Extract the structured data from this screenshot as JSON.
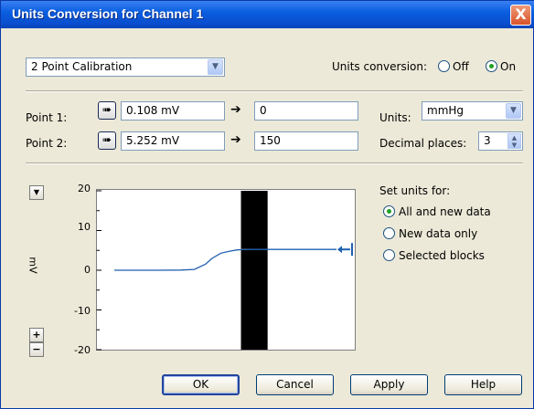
{
  "window": {
    "title": "Units Conversion for Channel 1",
    "close_glyph": "X"
  },
  "mode_select": {
    "value": "2 Point Calibration"
  },
  "units_conversion": {
    "label": "Units conversion:",
    "off_label": "Off",
    "on_label": "On",
    "selected": "On"
  },
  "points": [
    {
      "label": "Point 1:",
      "measured": "0.108 mV",
      "converted": "0"
    },
    {
      "label": "Point 2:",
      "measured": "5.252 mV",
      "converted": "150"
    }
  ],
  "units": {
    "label": "Units:",
    "value": "mmHg"
  },
  "decimal_places": {
    "label": "Decimal places:",
    "value": "3"
  },
  "chart": {
    "y_axis_label": "mV",
    "y_ticks": [
      "20",
      "10",
      "0",
      "-10",
      "-20"
    ],
    "zoom_in": "+",
    "zoom_out": "−"
  },
  "chart_data": {
    "type": "line",
    "ylabel": "mV",
    "ylim": [
      -20,
      20
    ],
    "x": [
      0,
      10,
      20,
      30,
      36,
      41,
      44,
      48,
      52,
      55,
      58,
      62,
      100
    ],
    "series": [
      {
        "values": [
          0,
          0,
          0,
          0.05,
          0.2,
          1.5,
          3,
          4.3,
          4.8,
          5.1,
          5.2,
          5.25,
          5.25
        ]
      }
    ],
    "selection_band_x": [
      57,
      69
    ],
    "grid": false
  },
  "set_units": {
    "label": "Set units for:",
    "options": [
      "All and new data",
      "New data only",
      "Selected blocks"
    ],
    "selected": "All and new data"
  },
  "buttons": {
    "ok": "OK",
    "cancel": "Cancel",
    "apply": "Apply",
    "help": "Help"
  }
}
